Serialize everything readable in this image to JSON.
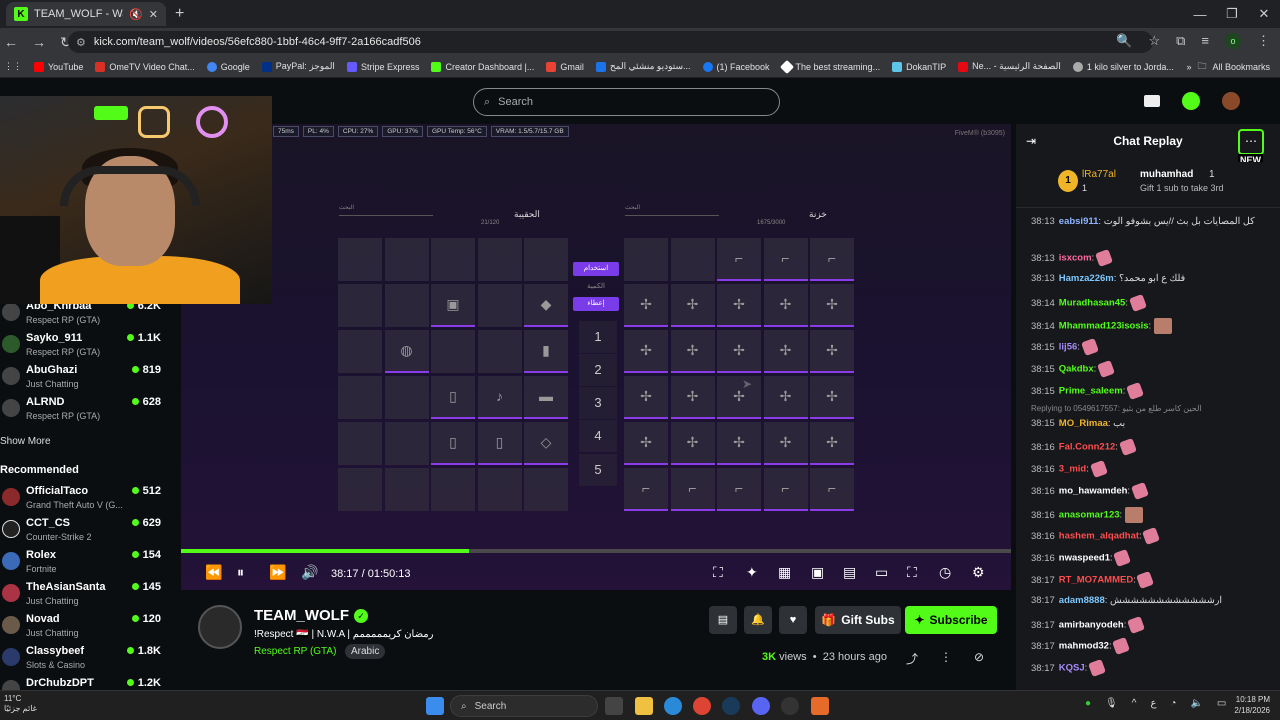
{
  "browser": {
    "tab_title": "TEAM_WOLF - Watch the V",
    "url": "kick.com/team_wolf/videos/56efc880-1bbf-46c4-9ff7-2a166cadf506",
    "bookmarks": [
      {
        "label": "YouTube",
        "color": "#ff0000"
      },
      {
        "label": "OmeTV Video Chat...",
        "color": "#d93025"
      },
      {
        "label": "Google",
        "color": "#4285f4"
      },
      {
        "label": "PayPal: الموجز",
        "color": "#003087"
      },
      {
        "label": "Stripe Express",
        "color": "#635bff"
      },
      {
        "label": "Creator Dashboard |...",
        "color": "#53fc18"
      },
      {
        "label": "Gmail",
        "color": "#ea4335"
      },
      {
        "label": "ستوديو منشئي المح...",
        "color": "#1a73e8"
      },
      {
        "label": "(1) Facebook",
        "color": "#1877f2"
      },
      {
        "label": "The best streaming...",
        "color": "#ffffff"
      },
      {
        "label": "DokanTIP",
        "color": "#5cc5e8"
      },
      {
        "label": "Ne... - الصفحة الرئيسية",
        "color": "#e50914"
      },
      {
        "label": "1 kilo silver to Jorda...",
        "color": "#aaaaaa"
      }
    ],
    "all_bookmarks": "All Bookmarks"
  },
  "header": {
    "search_placeholder": "Search"
  },
  "sidebar": {
    "following": [
      {
        "name": "Abo_Khrbaa",
        "category": "Respect RP (GTA)",
        "viewers": "6.2K"
      },
      {
        "name": "Sayko_911",
        "category": "Respect RP (GTA)",
        "viewers": "1.1K"
      },
      {
        "name": "AbuGhazi",
        "category": "Just Chatting",
        "viewers": "819"
      },
      {
        "name": "ALRND",
        "category": "Respect RP (GTA)",
        "viewers": "628"
      }
    ],
    "show_more": "Show More",
    "recommended_title": "Recommended",
    "recommended": [
      {
        "name": "OfficialTaco",
        "category": "Grand Theft Auto V (G...",
        "viewers": "512"
      },
      {
        "name": "CCT_CS",
        "category": "Counter-Strike 2",
        "viewers": "629"
      },
      {
        "name": "Rolex",
        "category": "Fortnite",
        "viewers": "154"
      },
      {
        "name": "TheAsianSanta",
        "category": "Just Chatting",
        "viewers": "145"
      },
      {
        "name": "Novad",
        "category": "Just Chatting",
        "viewers": "120"
      },
      {
        "name": "Classybeef",
        "category": "Slots & Casino",
        "viewers": "1.8K"
      },
      {
        "name": "DrChubzDPT",
        "category": "",
        "viewers": "1.2K"
      }
    ]
  },
  "game": {
    "hud": [
      "75ms",
      "PL: 4%",
      "CPU: 27%",
      "GPU: 37%",
      "GPU Temp: 56°C",
      "VRAM: 1.5/5.7/15.7 GB"
    ],
    "fivem": "FiveM® (b3095)",
    "bag_title": "الحقيبة",
    "bag_capacity": "21/120",
    "stash_title": "خزنة",
    "stash_capacity": "1675/3000",
    "search_label": "البحث",
    "btn_use": "استخدام",
    "btn_qty": "الكمية",
    "btn_give": "إعطاء",
    "slots": [
      "1",
      "2",
      "3",
      "4",
      "5"
    ]
  },
  "player": {
    "current_time": "38:17",
    "duration": "01:50:13",
    "progress_fraction": 0.347
  },
  "channel": {
    "name": "TEAM_WOLF",
    "stream_title": "!Respect 🇮🇶 | N.W.A | رمضان كريمممممم",
    "category": "Respect RP (GTA)",
    "language": "Arabic",
    "gift_label": "Gift Subs",
    "subscribe_label": "Subscribe",
    "views_count": "3K",
    "views_label": "views",
    "posted": "23 hours ago"
  },
  "chat": {
    "title": "Chat Replay",
    "new_label": "NEW",
    "gifter_rank": "1",
    "gifter1": "lRa77al",
    "gifter1_count": "1",
    "gifter2": "muhamhad",
    "gifter2_count": "1",
    "gifter2_note": "Gift 1 sub to take 3rd",
    "messages": [
      {
        "ts": "38:13",
        "user": "eabsi911",
        "color": "#8fb4ff",
        "text": "كل المصايات بل بث //يس بشوفو الوت"
      },
      {
        "ts": "38:13",
        "user": "isxcom",
        "color": "#ff6b9d",
        "text": ""
      },
      {
        "ts": "38:13",
        "user": "Hamza226m",
        "color": "#7ec8ff",
        "text": "فلك ع ابو محمد؟"
      },
      {
        "ts": "38:14",
        "user": "Muradhasan45",
        "color": "#53fc18",
        "text": ""
      },
      {
        "ts": "38:14",
        "user": "Mhammad123isosis",
        "color": "#53fc18",
        "text": ""
      },
      {
        "ts": "38:15",
        "user": "lij56",
        "color": "#a78bfa",
        "text": ""
      },
      {
        "ts": "38:15",
        "user": "Qakdbx",
        "color": "#53fc18",
        "text": ""
      },
      {
        "ts": "38:15",
        "user": "Prime_saleem",
        "color": "#53fc18",
        "text": ""
      },
      {
        "ts": "38:15",
        "user": "MO_Rimaa",
        "color": "#f0b429",
        "text": "بب"
      },
      {
        "ts": "38:16",
        "user": "Fal.Conn212",
        "color": "#ff4d4d",
        "text": ""
      },
      {
        "ts": "38:16",
        "user": "3_mid",
        "color": "#ff4d4d",
        "text": ""
      },
      {
        "ts": "38:16",
        "user": "mo_hawamdeh",
        "color": "#ffffff",
        "text": ""
      },
      {
        "ts": "38:16",
        "user": "anasomar123",
        "color": "#53fc18",
        "text": ""
      },
      {
        "ts": "38:16",
        "user": "hashem_alqadhat",
        "color": "#ff4d4d",
        "text": ""
      },
      {
        "ts": "38:16",
        "user": "nwaspeed1",
        "color": "#ffffff",
        "text": ""
      },
      {
        "ts": "38:17",
        "user": "RT_MO7AMMED",
        "color": "#ff4d4d",
        "text": ""
      },
      {
        "ts": "38:17",
        "user": "adam8888",
        "color": "#7ec8ff",
        "text": "ارشششششششششششش"
      },
      {
        "ts": "38:17",
        "user": "amirbanyodeh",
        "color": "#ffffff",
        "text": ""
      },
      {
        "ts": "38:17",
        "user": "mahmod32",
        "color": "#ffffff",
        "text": ""
      },
      {
        "ts": "38:17",
        "user": "KQSJ",
        "color": "#a78bfa",
        "text": ""
      }
    ],
    "reply_note": "Replying to 0549617557: الحين كاسر طلع من بثيو"
  },
  "taskbar": {
    "temp": "11°C",
    "weather_text": "غائم جزئيًا",
    "search": "Search",
    "lang": "ع",
    "time": "10:18 PM",
    "date": "2/18/2026"
  }
}
